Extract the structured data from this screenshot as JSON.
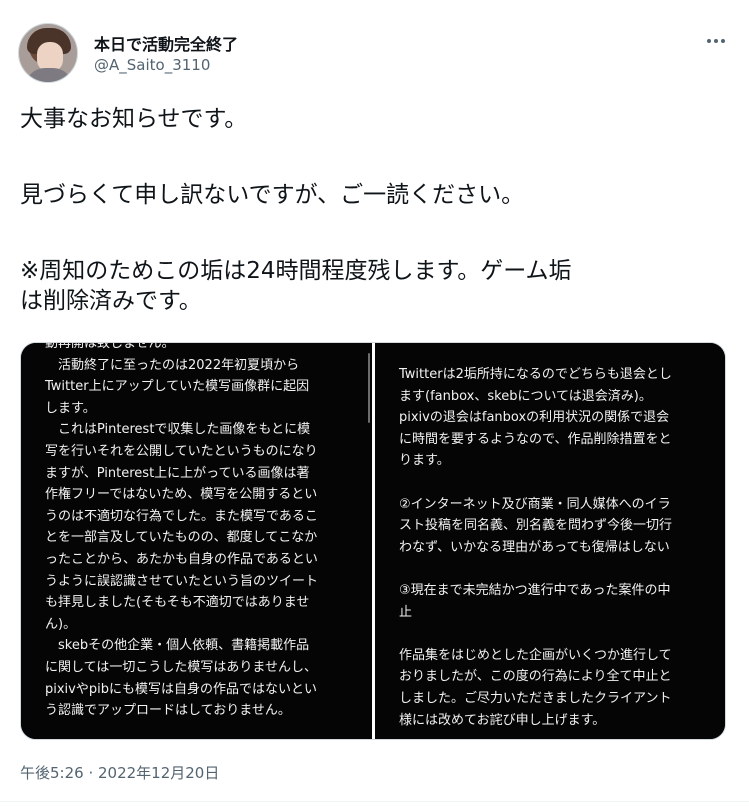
{
  "header": {
    "display_name": "本日で活動完全終了",
    "handle": "@A_Saito_3110",
    "more_icon": "ellipsis-icon"
  },
  "tweet": {
    "paragraphs": [
      "大事なお知らせです。",
      "見づらくて申し訳ないですが、ご一読ください。",
      "※周知のためこの垢は24時間程度残します。ゲーム垢\nは削除済みです。"
    ]
  },
  "media": {
    "left_text": "動再開は致しません。\n　活動終了に至ったのは2022年初夏頃から\nTwitter上にアップしていた模写画像群に起因\nします。\n　これはPinterestで収集した画像をもとに模\n写を行いそれを公開していたというものになり\nますが、Pinterest上に上がっている画像は著\n作権フリーではないため、模写を公開するとい\nうのは不適切な行為でした。また模写であるこ\nとを一部言及していたものの、都度してこなか\nったことから、あたかも自身の作品であるとい\nうように誤認識させていたという旨のツイート\nも拝見しました(そもそも不適切ではありませ\nん)。\n　skebその他企業・個人依頼、書籍掲載作品\nに関しては一切こうした模写はありませんし、\npixivやpibにも模写は自身の作品ではないとい\nう認識でアップロードはしておりません。",
    "right_text": "Twitterは2垢所持になるのでどちらも退会とし\nます(fanbox、skebについては退会済み)。\npixivの退会はfanboxの利用状況の関係で退会\nに時間を要するようなので、作品削除措置をと\nります。\n\n②インターネット及び商業・同人媒体へのイラ\nスト投稿を同名義、別名義を問わず今後一切行\nわなず、いかなる理由があっても復帰はしない\n\n③現在まで未完結かつ進行中であった案件の中\n止\n\n作品集をはじめとした企画がいくつか進行して\nおりましたが、この度の行為により全て中止と\nしました。ご尽力いただきましたクライアント\n様には改めてお詫び申し上げます。"
  },
  "timestamp": "午後5:26 · 2022年12月20日"
}
